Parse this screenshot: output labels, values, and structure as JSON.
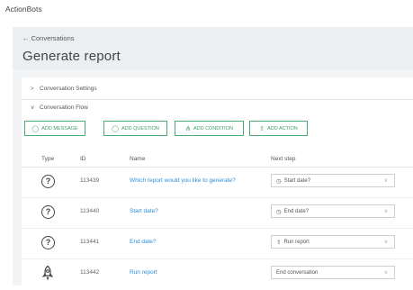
{
  "app": {
    "title": "ActionBots"
  },
  "header": {
    "back_label": "← Conversations",
    "title": "Generate report"
  },
  "sections": {
    "settings": "Conversation Settings",
    "flow": "Conversation Flow"
  },
  "buttons": {
    "add_message": "ADD MESSAGE",
    "add_question": "ADD QUESTION",
    "add_condition": "ADD CONDITION",
    "add_action": "ADD ACTION"
  },
  "table": {
    "headers": {
      "type": "Type",
      "id": "ID",
      "name": "Name",
      "next": "Next step"
    },
    "rows": [
      {
        "type_icon": "question-icon",
        "id": "113439",
        "name": "Which report would you like to generate?",
        "next_icon": "clock-icon",
        "next": "Start date?"
      },
      {
        "type_icon": "question-icon",
        "id": "113440",
        "name": "Start date?",
        "next_icon": "clock-icon",
        "next": "End date?"
      },
      {
        "type_icon": "question-icon",
        "id": "113441",
        "name": "End date?",
        "next_icon": "rocket-icon",
        "next": "Run report"
      },
      {
        "type_icon": "rocket-icon",
        "id": "113442",
        "name": "Run report",
        "next_icon": "",
        "next": "End conversation"
      }
    ]
  },
  "colors": {
    "accent_green": "#3f9f6a",
    "link_blue": "#2f8fd8",
    "header_bg": "#eceff1"
  }
}
